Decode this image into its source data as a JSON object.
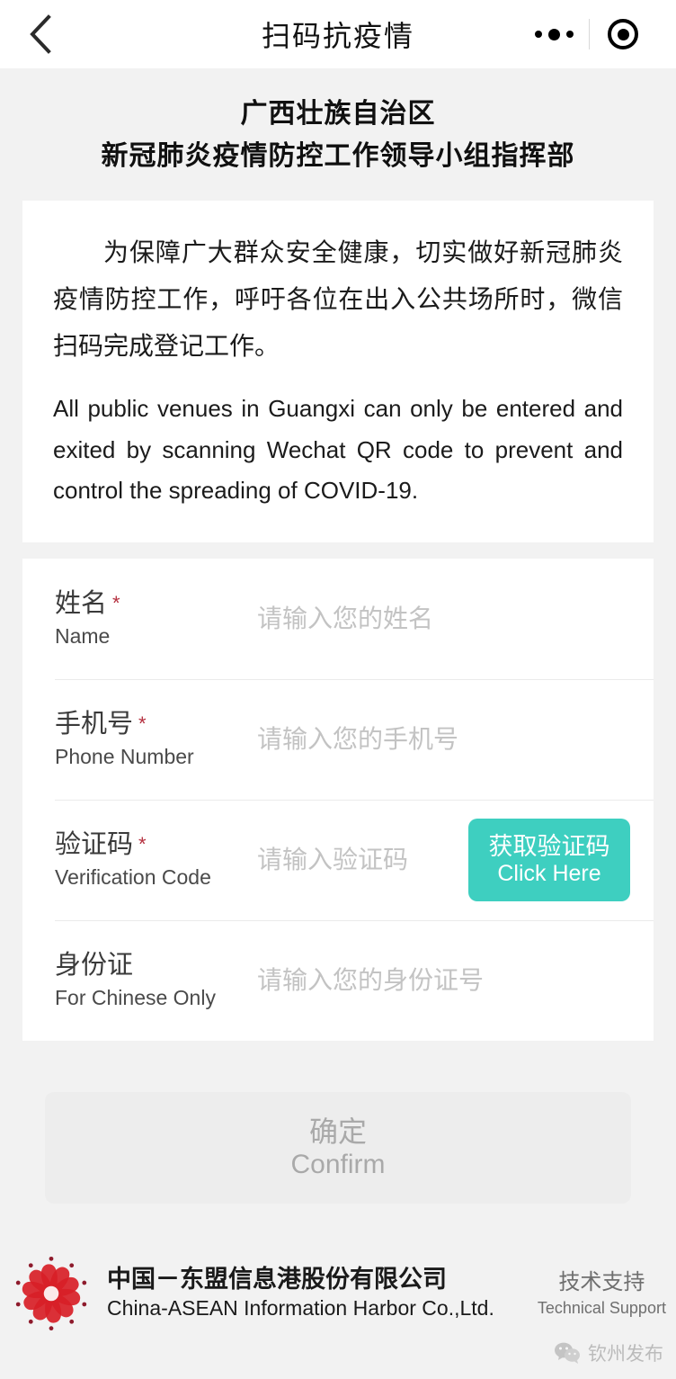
{
  "navbar": {
    "title": "扫码抗疫情",
    "back_icon": "chevron-left-icon",
    "menu_icon": "more-dots-icon",
    "target_icon": "target-circle-icon"
  },
  "org": {
    "line1": "广西壮族自治区",
    "line2": "新冠肺炎疫情防控工作领导小组指挥部"
  },
  "notice": {
    "chinese": "为保障广大群众安全健康，切实做好新冠肺炎疫情防控工作，呼吁各位在出入公共场所时，微信扫码完成登记工作。",
    "english": "All public venues in Guangxi can only be entered and exited by scanning Wechat QR code to prevent and control the spreading of COVID-19."
  },
  "form": {
    "required_mark": "*",
    "fields": [
      {
        "label_cn": "姓名",
        "label_en": "Name",
        "required": true,
        "placeholder": "请输入您的姓名",
        "value": ""
      },
      {
        "label_cn": "手机号",
        "label_en": "Phone Number",
        "required": true,
        "placeholder": "请输入您的手机号",
        "value": ""
      },
      {
        "label_cn": "验证码",
        "label_en": "Verification Code",
        "required": true,
        "placeholder": "请输入验证码",
        "value": "",
        "button_cn": "获取验证码",
        "button_en": "Click Here"
      },
      {
        "label_cn": "身份证",
        "label_en": "For Chinese Only",
        "required": false,
        "placeholder": "请输入您的身份证号",
        "value": ""
      }
    ]
  },
  "confirm": {
    "label_cn": "确定",
    "label_en": "Confirm"
  },
  "footer": {
    "logo_icon": "china-asean-flower-logo",
    "company_cn": "中国－东盟信息港股份有限公司",
    "company_en": "China-ASEAN Information Harbor Co.,Ltd.",
    "support_cn": "技术支持",
    "support_en": "Technical Support"
  },
  "watermark": {
    "icon": "wechat-icon",
    "text": "钦州发布"
  },
  "colors": {
    "accent_teal": "#3ecfc0",
    "required_red": "#b5303f",
    "page_bg": "#f2f2f2",
    "card_bg": "#ffffff",
    "disabled_btn": "#ededed",
    "logo_red": "#d81f27"
  }
}
